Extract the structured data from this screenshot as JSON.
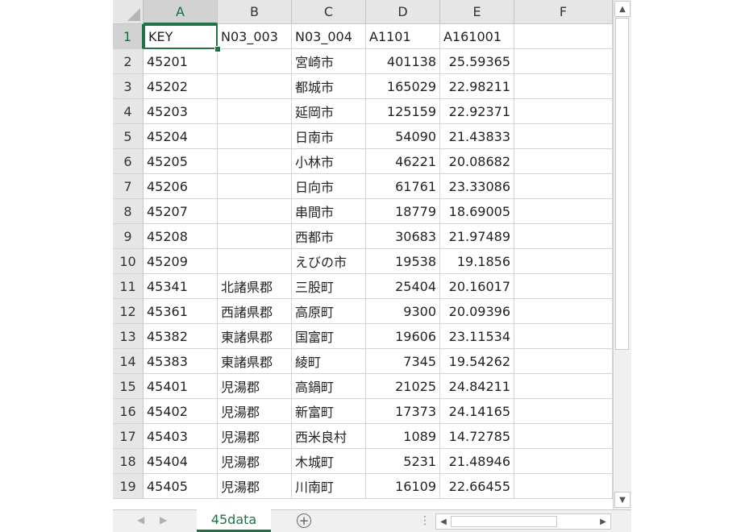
{
  "columns": [
    "A",
    "B",
    "C",
    "D",
    "E",
    "F"
  ],
  "active_cell": "A1",
  "rows": [
    {
      "num": "1",
      "cells": [
        "KEY",
        "N03_003",
        "N03_004",
        "A1101",
        "A161001"
      ]
    },
    {
      "num": "2",
      "cells": [
        "45201",
        "",
        "宮崎市",
        "401138",
        "25.59365"
      ]
    },
    {
      "num": "3",
      "cells": [
        "45202",
        "",
        "都城市",
        "165029",
        "22.98211"
      ]
    },
    {
      "num": "4",
      "cells": [
        "45203",
        "",
        "延岡市",
        "125159",
        "22.92371"
      ]
    },
    {
      "num": "5",
      "cells": [
        "45204",
        "",
        "日南市",
        "54090",
        "21.43833"
      ]
    },
    {
      "num": "6",
      "cells": [
        "45205",
        "",
        "小林市",
        "46221",
        "20.08682"
      ]
    },
    {
      "num": "7",
      "cells": [
        "45206",
        "",
        "日向市",
        "61761",
        "23.33086"
      ]
    },
    {
      "num": "8",
      "cells": [
        "45207",
        "",
        "串間市",
        "18779",
        "18.69005"
      ]
    },
    {
      "num": "9",
      "cells": [
        "45208",
        "",
        "西都市",
        "30683",
        "21.97489"
      ]
    },
    {
      "num": "10",
      "cells": [
        "45209",
        "",
        "えびの市",
        "19538",
        "19.1856"
      ]
    },
    {
      "num": "11",
      "cells": [
        "45341",
        "北諸県郡",
        "三股町",
        "25404",
        "20.16017"
      ]
    },
    {
      "num": "12",
      "cells": [
        "45361",
        "西諸県郡",
        "高原町",
        "9300",
        "20.09396"
      ]
    },
    {
      "num": "13",
      "cells": [
        "45382",
        "東諸県郡",
        "国富町",
        "19606",
        "23.11534"
      ]
    },
    {
      "num": "14",
      "cells": [
        "45383",
        "東諸県郡",
        "綾町",
        "7345",
        "19.54262"
      ]
    },
    {
      "num": "15",
      "cells": [
        "45401",
        "児湯郡",
        "高鍋町",
        "21025",
        "24.84211"
      ]
    },
    {
      "num": "16",
      "cells": [
        "45402",
        "児湯郡",
        "新富町",
        "17373",
        "24.14165"
      ]
    },
    {
      "num": "17",
      "cells": [
        "45403",
        "児湯郡",
        "西米良村",
        "1089",
        "14.72785"
      ]
    },
    {
      "num": "18",
      "cells": [
        "45404",
        "児湯郡",
        "木城町",
        "5231",
        "21.48946"
      ]
    },
    {
      "num": "19",
      "cells": [
        "45405",
        "児湯郡",
        "川南町",
        "16109",
        "22.66455"
      ]
    }
  ],
  "sheet_tab": {
    "label": "45data"
  },
  "icons": {
    "add_sheet": "plus-circle-icon",
    "scroll_up": "triangle-up-icon",
    "scroll_down": "triangle-down-icon",
    "scroll_left": "triangle-left-icon",
    "scroll_right": "triangle-right-icon",
    "tab_nav_prev": "chevron-left-icon",
    "tab_nav_next": "chevron-right-icon"
  },
  "colors": {
    "accent": "#217346"
  }
}
